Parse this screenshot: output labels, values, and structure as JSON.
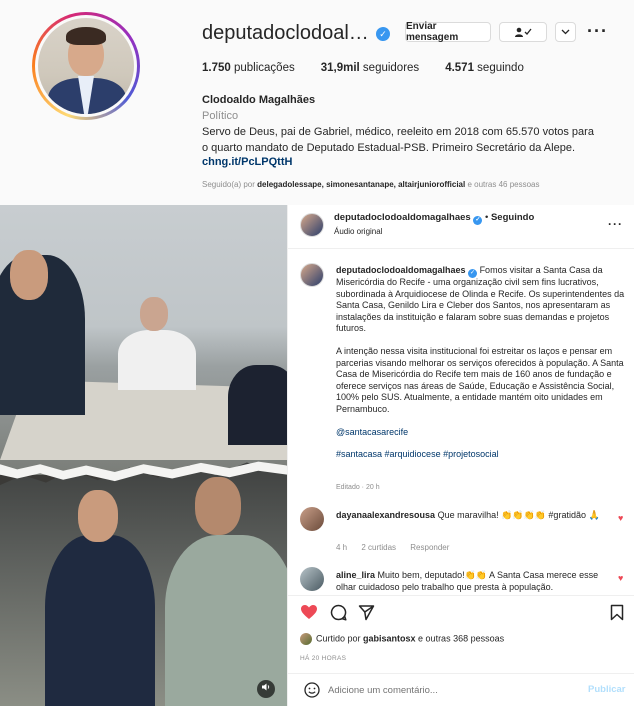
{
  "profile": {
    "username": "deputadoclodoaldo...",
    "message_button": "Enviar mensagem",
    "following_icon": "user-check-icon",
    "chevron_icon": "chevron-down-icon",
    "more_icon": "more-dots-icon",
    "stats": {
      "posts_count": "1.750",
      "posts_label": "publicações",
      "followers_count": "31,9mil",
      "followers_label": "seguidores",
      "following_count": "4.571",
      "following_label": "seguindo"
    },
    "full_name": "Clodoaldo Magalhães",
    "category": "Político",
    "bio": "Servo de Deus, pai de Gabriel, médico, reeleito em 2018 com 65.570 votos para o quarto mandato de Deputado Estadual-PSB. Primeiro Secretário da Alepe.",
    "link": "chng.it/PcLPQttH",
    "followed_by_prefix": "Seguido(a) por ",
    "followed_by_names": "delegadolessape, simonesantanape, altairjuniorofficial",
    "followed_by_suffix": " e outras 46 pessoas"
  },
  "post": {
    "header": {
      "username": "deputadoclodoaldomagalhaes",
      "separator": " • ",
      "follow_status": "Seguindo",
      "audio": "Áudio original"
    },
    "caption": {
      "username": "deputadoclodoaldomagalhaes",
      "paragraph1": "Fomos visitar a Santa Casa da Misericórdia do Recife - uma organização civil sem fins lucrativos, subordinada à Arquidiocese de Olinda e Recife. Os superintendentes da Santa Casa, Genildo Lira e Cleber dos Santos, nos apresentaram as instalações da instituição e falaram sobre suas demandas e projetos futuros.",
      "paragraph2": "A intenção nessa visita institucional foi estreitar os laços e pensar em parcerias visando melhorar os serviços oferecidos à população. A Santa Casa de Misericórdia do Recife tem mais de 160 anos de fundação e oferece serviços nas áreas de Saúde, Educação e Assistência Social, 100% pelo SUS. Atualmente, a entidade mantém oito unidades em Pernambuco.",
      "mention": "@santacasarecife",
      "hashtags": "#santacasa #arquidiocese #projetosocial",
      "edited": "Editado · 20 h"
    },
    "comments": [
      {
        "username": "dayanaalexandresousa",
        "text": "Que maravilha! 👏👏👏👏 #gratidão 🙏",
        "time": "4 h",
        "likes": "2 curtidas",
        "reply": "Responder"
      },
      {
        "username": "aline_lira",
        "text": "Muito bem, deputado!👏👏 A Santa Casa merece esse olhar cuidadoso pelo trabalho que presta à população."
      }
    ],
    "liked_by_prefix": "Curtido por ",
    "liked_by_user": "gabisantosx",
    "liked_by_suffix": " e outras 368 pessoas",
    "posted_ago": "HÁ 20 HORAS",
    "add_comment_placeholder": "Adicione um comentário...",
    "publish_label": "Publicar"
  },
  "icons": {
    "verified": "verified-badge-icon",
    "like": "heart-icon",
    "comment": "comment-bubble-icon",
    "share": "paper-plane-icon",
    "save": "bookmark-icon",
    "emoji": "smiley-icon",
    "audio": "speaker-icon"
  },
  "colors": {
    "verified_blue": "#3897f0",
    "like_red": "#ed4956",
    "link_blue": "#00376b",
    "publish_disabled": "#b2dffc"
  }
}
